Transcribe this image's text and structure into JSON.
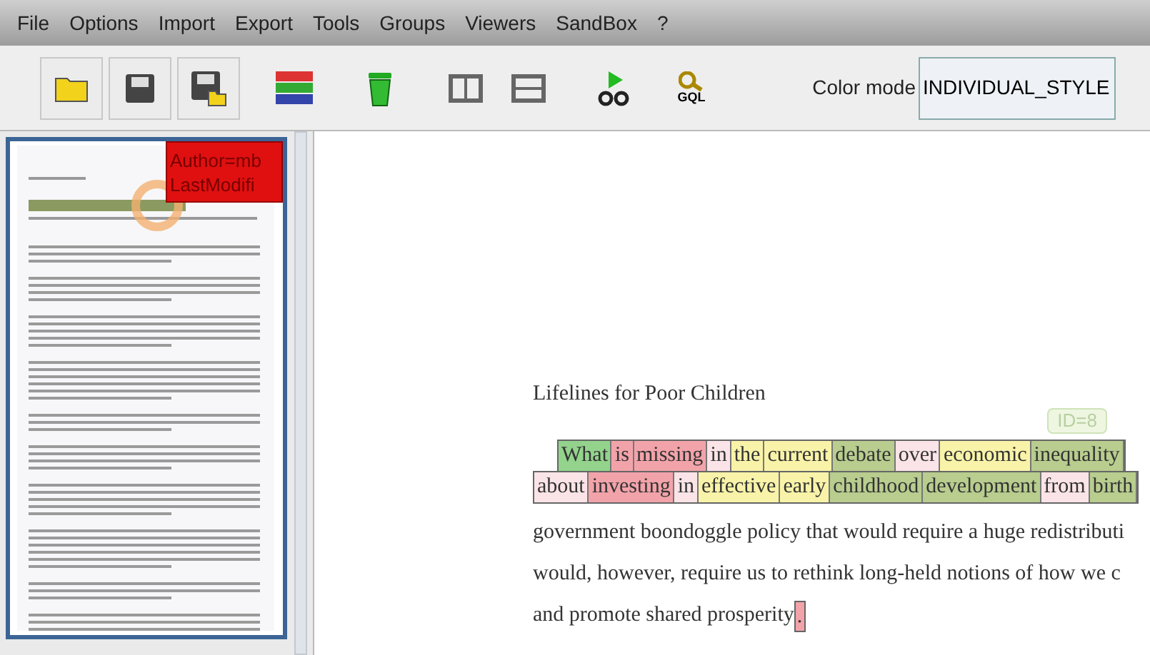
{
  "menu": [
    "File",
    "Options",
    "Import",
    "Export",
    "Tools",
    "Groups",
    "Viewers",
    "SandBox",
    "?"
  ],
  "toolbar": [
    {
      "kind": "folder"
    },
    {
      "kind": "save"
    },
    {
      "kind": "save-as"
    },
    {
      "kind": "colors"
    },
    {
      "kind": "trash"
    },
    {
      "kind": "columns"
    },
    {
      "kind": "rows"
    },
    {
      "kind": "run"
    },
    {
      "kind": "gql",
      "text": "GQL"
    }
  ],
  "color_mode": {
    "label": "Color mode",
    "value": "INDIVIDUAL_STYLE"
  },
  "thumbnail": {
    "overlay": [
      "Author=mb",
      "LastModifi"
    ]
  },
  "document": {
    "title": "Lifelines for Poor Children",
    "badge": "ID=8",
    "token_lines": [
      [
        {
          "text": "What",
          "color": "#93d38c"
        },
        {
          "text": "is",
          "color": "#f2a3aa"
        },
        {
          "text": "missing",
          "color": "#f2a3aa"
        },
        {
          "text": "in",
          "color": "#fbe4e7"
        },
        {
          "text": "the",
          "color": "#f8f3a8"
        },
        {
          "text": "current",
          "color": "#f8f3a8"
        },
        {
          "text": "debate",
          "color": "#b8cd8e"
        },
        {
          "text": "over",
          "color": "#fbe4e7"
        },
        {
          "text": "economic",
          "color": "#f8f3a8"
        },
        {
          "text": "inequality",
          "color": "#b8cd8e"
        }
      ],
      [
        {
          "text": "about",
          "color": "#fbe4e7"
        },
        {
          "text": "investing",
          "color": "#f2a3aa"
        },
        {
          "text": "in",
          "color": "#fbe4e7"
        },
        {
          "text": "effective",
          "color": "#f8f3a8"
        },
        {
          "text": "early",
          "color": "#f8f3a8"
        },
        {
          "text": "childhood",
          "color": "#b8cd8e"
        },
        {
          "text": "development",
          "color": "#b8cd8e"
        },
        {
          "text": "from",
          "color": "#fbe4e7"
        },
        {
          "text": "birth",
          "color": "#b8cd8e"
        }
      ]
    ],
    "lines": [
      "government boondoggle policy that would require a huge redistributi",
      "would, however, require us to rethink long-held notions of how we c",
      "and promote shared prosperity"
    ],
    "end_token": {
      "text": ".",
      "color": "#f2a3aa"
    }
  }
}
